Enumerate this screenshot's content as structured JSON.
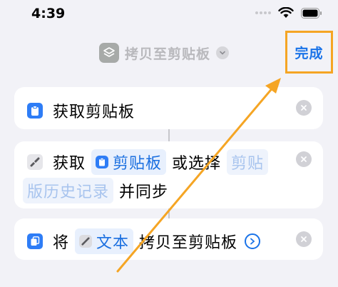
{
  "status_bar": {
    "time": "4:39"
  },
  "nav": {
    "title": "拷贝至剪贴板",
    "done_label": "完成"
  },
  "actions": [
    {
      "text": "获取剪贴板"
    },
    {
      "verb": "获取",
      "token": "剪贴板",
      "connector": "或选择",
      "option_line1": "剪贴",
      "option_line2": "版历史记录",
      "tail": "并同步"
    },
    {
      "verb": "将",
      "token": "文本",
      "tail": "拷贝至剪贴板"
    }
  ],
  "colors": {
    "accent": "#1a73e8",
    "highlight": "#f5a524",
    "background": "#f2f2f7"
  },
  "icons": [
    "wifi-icon",
    "battery-icon",
    "shortcut-layers-icon",
    "chevron-down-icon",
    "clipboard-icon",
    "variable-icon",
    "copy-icon",
    "close-icon",
    "chevron-right-icon"
  ]
}
